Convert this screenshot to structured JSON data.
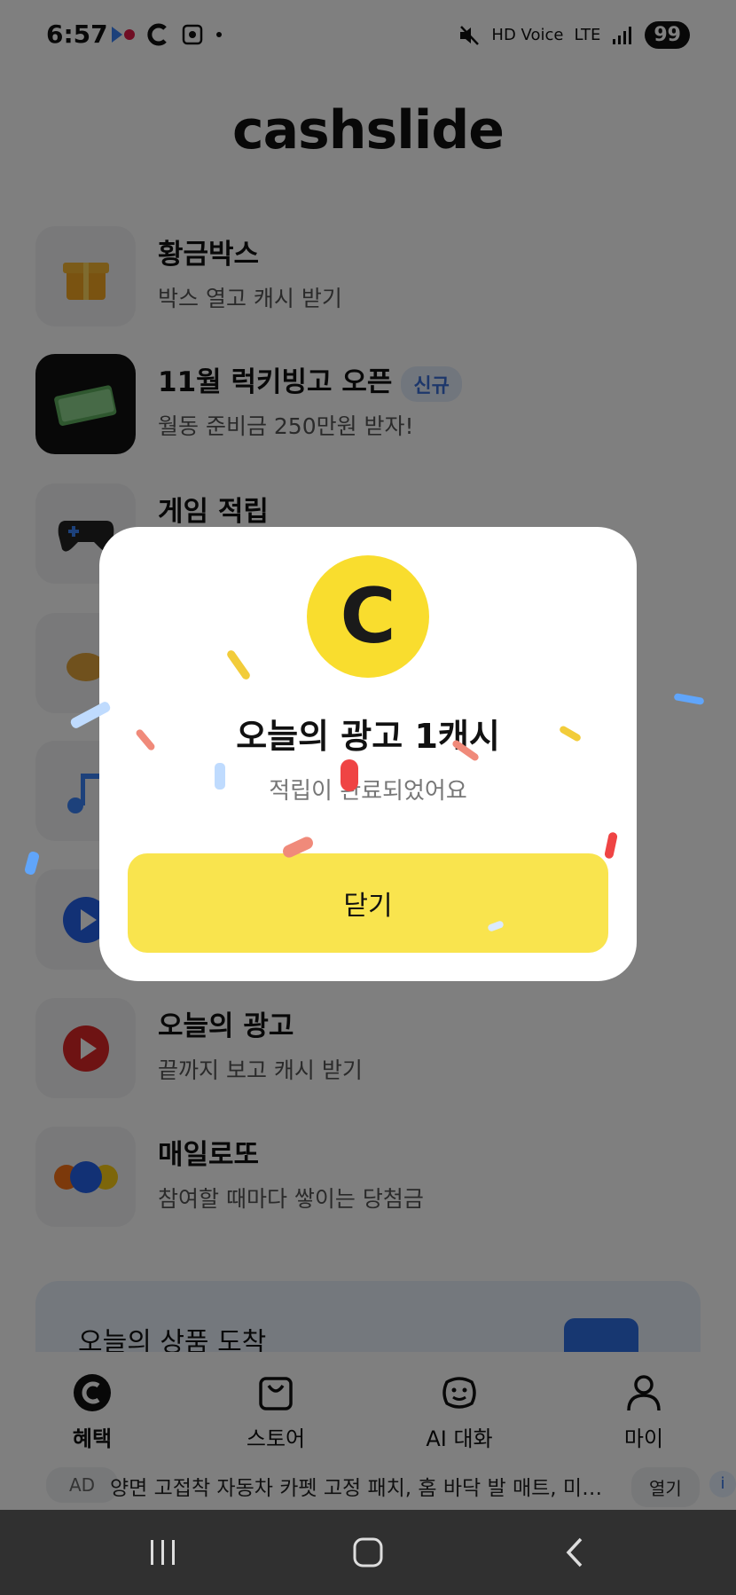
{
  "status_bar": {
    "time": "6:57",
    "battery": "99",
    "hd_voice": "HD Voice",
    "lte": "LTE"
  },
  "header": {
    "logo": "cashslide"
  },
  "list": {
    "items": [
      {
        "title": "황금박스",
        "subtitle": "박스 열고 캐시 받기",
        "icon": "gift-icon"
      },
      {
        "title": "11월 럭키빙고 오픈",
        "badge": "신규",
        "subtitle": "월동 준비금 250만원 받자!",
        "icon": "money-stack-icon"
      },
      {
        "title": "게임 적립",
        "subtitle": "",
        "icon": "gamepad-icon"
      },
      {
        "title": "",
        "subtitle": "",
        "icon": "hand-icon"
      },
      {
        "title": "",
        "subtitle": "",
        "icon": "music-note-icon"
      },
      {
        "title": "",
        "subtitle": "",
        "icon": "play-blue-icon"
      },
      {
        "title": "오늘의 광고",
        "subtitle": "끝까지 보고 캐시 받기",
        "icon": "play-red-icon"
      },
      {
        "title": "매일로또",
        "subtitle": "참여할 때마다 쌓이는 당첨금",
        "icon": "lotto-ball-icon"
      }
    ]
  },
  "promo": {
    "text": "오늘의 상품 도착"
  },
  "dialog": {
    "coin_letter": "C",
    "title": "오늘의 광고 1캐시",
    "subtitle": "적립이 완료되었어요",
    "close_label": "닫기"
  },
  "bottom_nav": {
    "items": [
      {
        "label": "혜택",
        "icon": "cash-c-icon",
        "active": true
      },
      {
        "label": "스토어",
        "icon": "shopping-bag-icon",
        "active": false
      },
      {
        "label": "AI 대화",
        "icon": "ai-face-icon",
        "active": false
      },
      {
        "label": "마이",
        "icon": "person-icon",
        "active": false
      }
    ]
  },
  "ad_bar": {
    "tag": "AD",
    "text": "양면 고접착 자동차 카펫 고정 패치, 홈 바닥 발 매트, 미끄럼...",
    "open_label": "열기",
    "info": "i"
  },
  "colors": {
    "accent_yellow": "#F9DD2E",
    "button_yellow": "#F9E44E",
    "badge_blue": "#3B6FD6"
  }
}
